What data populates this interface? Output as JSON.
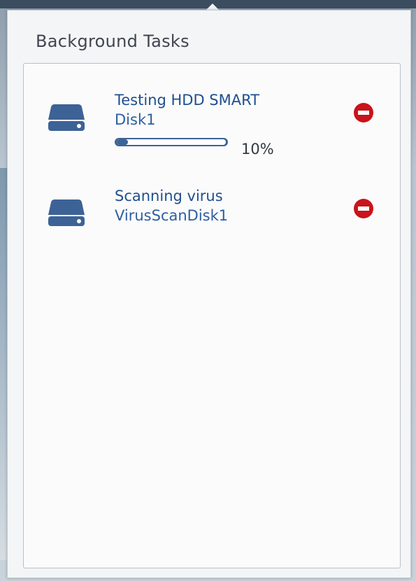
{
  "popup": {
    "title": "Background Tasks"
  },
  "tasks": [
    {
      "icon": "hard-drive-icon",
      "title": "Testing HDD SMART",
      "target": "Disk1",
      "progress_percent": 10,
      "progress_label": "10%",
      "cancel_icon": "remove-icon"
    },
    {
      "icon": "hard-drive-icon",
      "title": "Scanning virus",
      "target": "VirusScanDisk1",
      "cancel_icon": "remove-icon"
    }
  ],
  "colors": {
    "task_text": "#1f4f8f",
    "progress": "#3d6296",
    "cancel": "#c8141a"
  }
}
